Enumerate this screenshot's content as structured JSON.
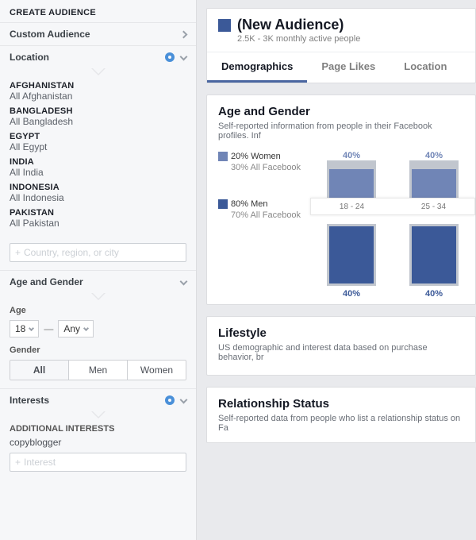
{
  "sidebar": {
    "header": "CREATE AUDIENCE",
    "custom_audience_label": "Custom Audience",
    "location": {
      "label": "Location",
      "items": [
        {
          "head": "AFGHANISTAN",
          "sub": "All Afghanistan"
        },
        {
          "head": "BANGLADESH",
          "sub": "All Bangladesh"
        },
        {
          "head": "EGYPT",
          "sub": "All Egypt"
        },
        {
          "head": "INDIA",
          "sub": "All India"
        },
        {
          "head": "INDONESIA",
          "sub": "All Indonesia"
        },
        {
          "head": "PAKISTAN",
          "sub": "All Pakistan"
        }
      ],
      "input_placeholder": "Country, region, or city"
    },
    "age_gender": {
      "section_label": "Age and Gender",
      "age_label": "Age",
      "age_from": "18",
      "age_to": "Any",
      "gender_label": "Gender",
      "gender_options": [
        "All",
        "Men",
        "Women"
      ],
      "gender_selected": "All"
    },
    "interests": {
      "label": "Interests",
      "additional_label": "ADDITIONAL INTERESTS",
      "items": [
        "copyblogger"
      ],
      "input_placeholder": "Interest"
    }
  },
  "main": {
    "audience": {
      "title": "(New Audience)",
      "subtitle": "2.5K - 3K monthly active people"
    },
    "tabs": [
      "Demographics",
      "Page Likes",
      "Location"
    ],
    "active_tab": "Demographics",
    "panels": {
      "age_gender": {
        "title": "Age and Gender",
        "subtitle": "Self-reported information from people in their Facebook profiles. Inf"
      },
      "lifestyle": {
        "title": "Lifestyle",
        "subtitle": "US demographic and interest data based on purchase behavior, br"
      },
      "relationship": {
        "title": "Relationship Status",
        "subtitle": "Self-reported data from people who list a relationship status on Fa"
      }
    }
  },
  "chart_data": {
    "type": "bar",
    "legend": {
      "women": {
        "label": "20% Women",
        "sub": "30% All Facebook",
        "color": "#7085b6"
      },
      "men": {
        "label": "80% Men",
        "sub": "70% All Facebook",
        "color": "#3b5998"
      }
    },
    "categories": [
      "18 - 24",
      "25 - 34"
    ],
    "series": [
      {
        "name": "Women",
        "values": [
          40,
          40
        ],
        "labels": [
          "40%",
          "40%"
        ]
      },
      {
        "name": "Men",
        "values": [
          40,
          40
        ],
        "labels": [
          "40%",
          "40%"
        ]
      }
    ]
  }
}
